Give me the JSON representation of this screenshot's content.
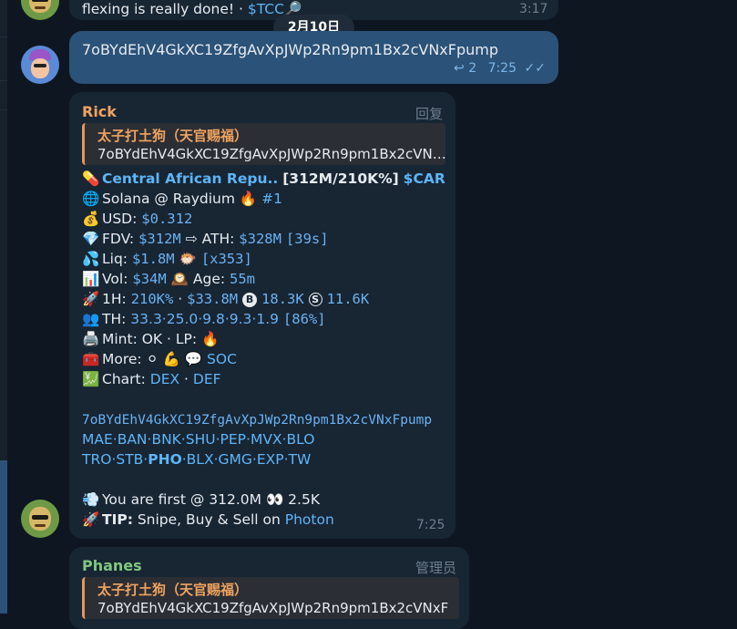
{
  "top": {
    "text_partial": "flexing is really done! · ",
    "ticker": "$TCC",
    "emoji": "🔎",
    "time": "3:17"
  },
  "date_badge": "2月10日",
  "own_message": {
    "text": "7oBYdEhV4GkXC19ZfgAvXpJWp2Rn9pm1Bx2cVNxFpump",
    "reply_count": "2",
    "time": "7:25"
  },
  "rick": {
    "sender": "Rick",
    "role": "回复",
    "quote_name": "太子打土狗（天官赐福）",
    "quote_text": "7oBYdEhV4GkXC19ZfgAvXpJWp2Rn9pm1Bx2cVN…",
    "token_name": "Central African Repu..",
    "token_stats": "[312M/210K%]",
    "ticker": "$CAR",
    "chain": "Solana @ Raydium",
    "rank": "#1",
    "usd_label": "USD:",
    "usd_value": "$0.312",
    "fdv_label": "FDV:",
    "fdv_value": "$312M",
    "ath_label": "⇨ ATH:",
    "ath_value": "$328M",
    "ath_age": "[39s]",
    "liq_label": "Liq:",
    "liq_value": "$1.8M",
    "liq_mult": "[x353]",
    "vol_label": "Vol:",
    "vol_value": "$34M",
    "age_label": "Age:",
    "age_value": "55m",
    "h1_label": "1H:",
    "h1_pct": "210K%",
    "h1_dot": " · ",
    "h1_vol": "$33.8M",
    "h1_buys": "18.3K",
    "h1_sells": "11.6K",
    "th_label": "TH:",
    "th_values": "33.3·25.0·9.8·9.3·1.9",
    "th_total": "[86%]",
    "mint_text": "Mint: OK · LP: 🔥",
    "more_label": "More:",
    "more_soc": "SOC",
    "chart_label": "Chart:",
    "chart_dex": "DEX",
    "chart_sep": " · ",
    "chart_def": "DEF",
    "contract": "7oBYdEhV4GkXC19ZfgAvXpJWp2Rn9pm1Bx2cVNxFpump",
    "bots_line1": "MAE·BAN·BNK·SHU·PEP·MVX·BLO",
    "bots_line2_a": "TRO·STB·",
    "bots_line2_b": "PHO",
    "bots_line2_c": "·BLX·GMG·EXP·TW",
    "first_text": "You are first @ 312.0M 👀 2.5K",
    "tip_label": "TIP:",
    "tip_text": " Snipe, Buy & Sell on ",
    "tip_link": "Photon",
    "time": "7:25"
  },
  "phanes": {
    "sender": "Phanes",
    "role": "管理员",
    "quote_name": "太子打土狗（天官赐福）",
    "quote_text": "7oBYdEhV4GkXC19ZfgAvXpJWp2Rn9pm1Bx2cVNxF"
  },
  "icons": {
    "pill": "💊",
    "globe": "🌐",
    "money": "💰",
    "gem": "💎",
    "drops": "💦",
    "chart": "📊",
    "rocket": "🚀",
    "people": "👥",
    "printer": "🖨️",
    "toolbox": "🧰",
    "exchange": "💹",
    "fire": "🔥",
    "blowfish": "🐡",
    "clock": "🕰️",
    "ring": "⚪",
    "muscle": "💪",
    "speech": "💬",
    "dash": "💨"
  },
  "colors": {
    "bg": "#0e1621",
    "bubble_in": "#182533",
    "bubble_out": "#2b5278",
    "link": "#5eb5f7",
    "sender_rick": "#f0a35f",
    "sender_phanes": "#7fc97f"
  }
}
